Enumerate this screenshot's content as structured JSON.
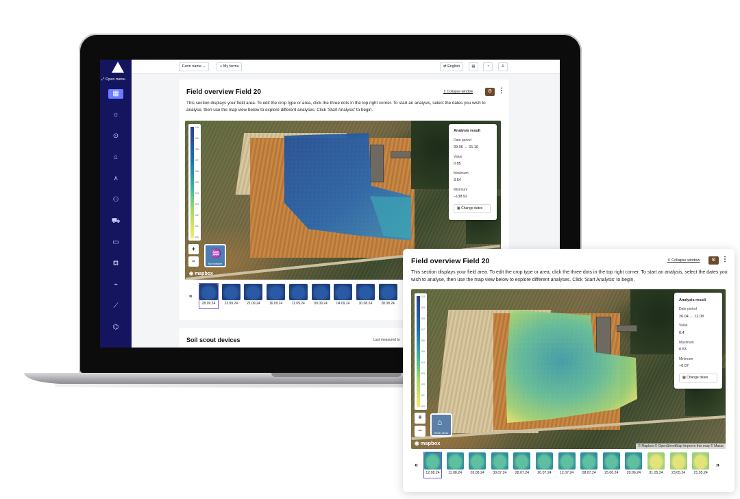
{
  "sidebar": {
    "open_menu": "Open menu",
    "items": [
      {
        "icon": "dashboard-icon",
        "glyph": "▦",
        "active": true
      },
      {
        "icon": "sun-icon",
        "glyph": "☼"
      },
      {
        "icon": "location-pin-icon",
        "glyph": "⊙"
      },
      {
        "icon": "home-icon",
        "glyph": "⌂"
      },
      {
        "icon": "network-icon",
        "glyph": "⋏"
      },
      {
        "icon": "users-icon",
        "glyph": "⚇"
      },
      {
        "icon": "tractor-icon",
        "glyph": "⛟"
      },
      {
        "icon": "chat-icon",
        "glyph": "▭"
      },
      {
        "icon": "cart-icon",
        "glyph": "⛾"
      },
      {
        "icon": "attachment-icon",
        "glyph": "⌁"
      },
      {
        "icon": "signature-icon",
        "glyph": "⟋"
      },
      {
        "icon": "graduation-icon",
        "glyph": "⌬"
      }
    ]
  },
  "topbar": {
    "farm_name": "Farm name",
    "my_farms": "My farms",
    "language": "English"
  },
  "laptop_card": {
    "title": "Field overview Field 20",
    "description": "This section displays your field area. To edit the crop type or area, click the three dots in the top right corner. To start an analysis, select the dates you wish to analyse, then use the map view below to explore different analyses. Click 'Start Analysis' to begin.",
    "collapse": "Collapse window",
    "result": {
      "title": "Analysis result",
      "date_label": "Date period",
      "date_value": "09.06 → 01.10",
      "value_label": "Value",
      "value": "0.85",
      "max_label": "Maximum",
      "max": "3.64",
      "min_label": "Minimum",
      "min": "−138.92",
      "change_btn": "Change dates"
    },
    "layer_label": "Soil moisture",
    "mapbox": "mapbox",
    "thumbs": [
      "28.09.24",
      "23.09.24",
      "21.09.24",
      "16.09.24",
      "11.09.24",
      "09.09.24",
      "04.09.24",
      "30.08.24",
      "28.08.24"
    ]
  },
  "soil_card": {
    "title": "Soil scout devices",
    "last_measured": "Last measured to"
  },
  "legend_ticks": [
    "1.0",
    "0.9",
    "0.8",
    "0.7",
    "0.6",
    "0.5",
    "0.4",
    "0.3",
    "0.2",
    "0.1",
    "0.0"
  ],
  "panel": {
    "title": "Field overview Field 20",
    "description": "This section displays your field area. To edit the crop type or area, click the three dots in the top right corner. To start an analysis, select the dates you wish to analyse, then use the map view below to explore different analyses. Click 'Start Analysis' to begin.",
    "collapse": "Collapse window",
    "result": {
      "title": "Analysis result",
      "date_label": "Date period",
      "date_value": "26.04 → 12.08",
      "value_label": "Value",
      "value": "0.4",
      "max_label": "Maximum",
      "max": "0.53",
      "min_label": "Minimum",
      "min": "−0.07",
      "change_btn": "Change dates"
    },
    "layer_label": "Winter stress",
    "mapbox": "mapbox",
    "attribution": "© Mapbox © OpenStreetMap Improve this map © Maxar",
    "thumbs": [
      "12.08.24",
      "11.08.24",
      "02.08.24",
      "30.07.24",
      "28.07.24",
      "20.07.24",
      "12.07.24",
      "08.07.24",
      "25.06.24",
      "20.06.24",
      "31.05.24",
      "23.05.24",
      "21.05.24"
    ],
    "prev": "«",
    "next": "»"
  },
  "colors": {
    "sidebar": "#15155f",
    "accent": "#6a7cff",
    "brown": "#6b4a2c"
  }
}
